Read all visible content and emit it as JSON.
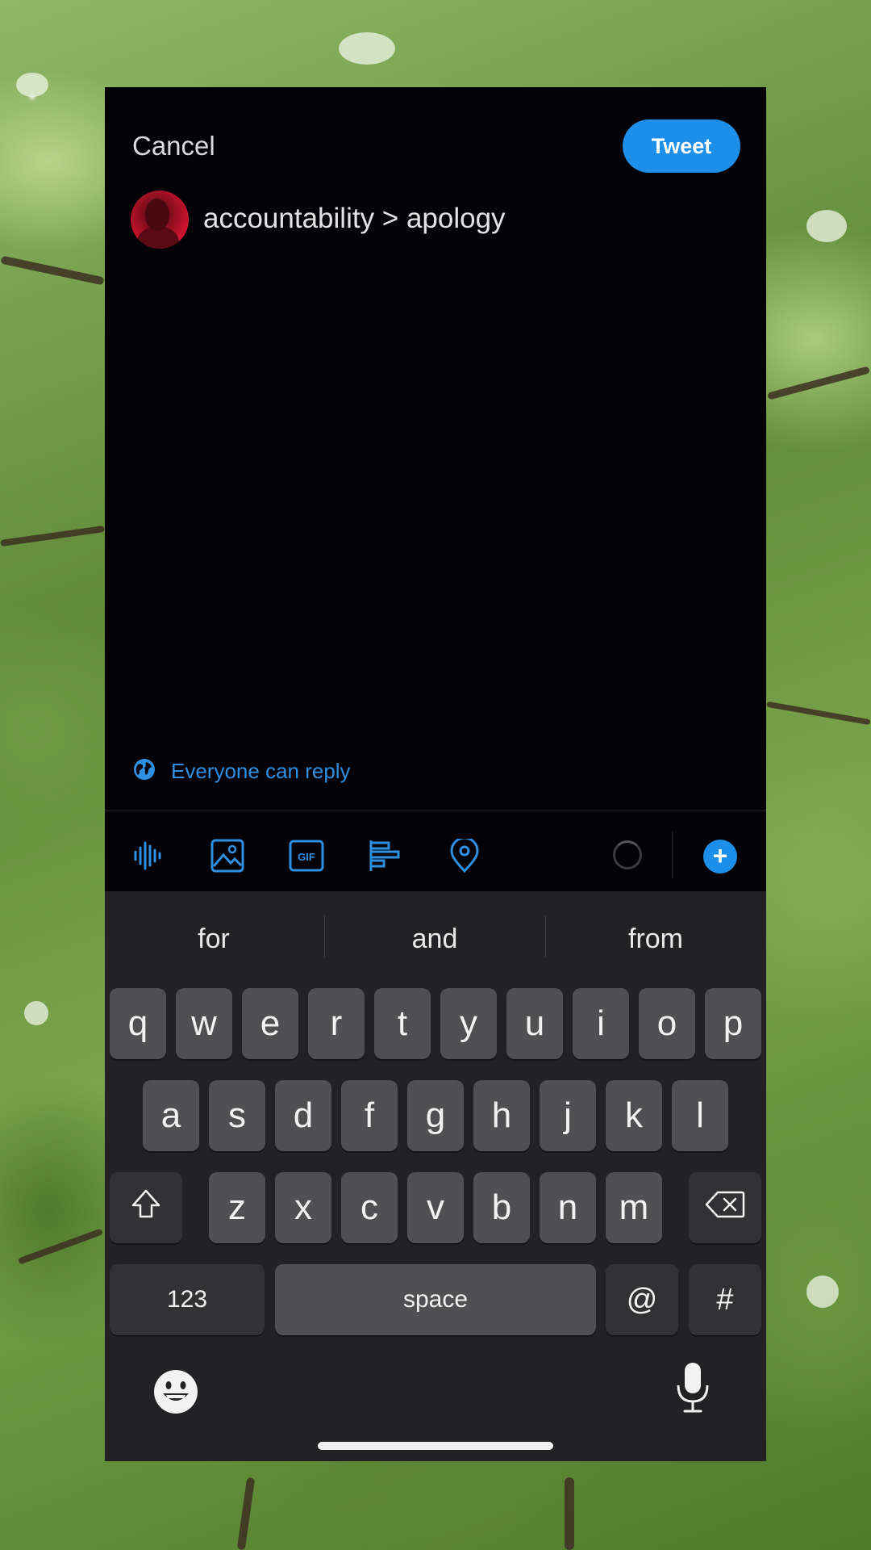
{
  "header": {
    "cancel_label": "Cancel",
    "tweet_label": "Tweet"
  },
  "compose": {
    "text": "accountability > apology"
  },
  "reply": {
    "label": "Everyone can reply"
  },
  "toolbar": {
    "icons": [
      "voice-icon",
      "image-icon",
      "gif-icon",
      "poll-icon",
      "location-icon"
    ],
    "gif_label": "GIF"
  },
  "keyboard": {
    "suggestions": [
      "for",
      "and",
      "from"
    ],
    "row1": [
      "q",
      "w",
      "e",
      "r",
      "t",
      "y",
      "u",
      "i",
      "o",
      "p"
    ],
    "row2": [
      "a",
      "s",
      "d",
      "f",
      "g",
      "h",
      "j",
      "k",
      "l"
    ],
    "row3": [
      "z",
      "x",
      "c",
      "v",
      "b",
      "n",
      "m"
    ],
    "numbers_label": "123",
    "space_label": "space",
    "at_label": "@",
    "hash_label": "#"
  },
  "colors": {
    "accent": "#1d8fe8",
    "compose_bg": "#030207",
    "keyboard_bg": "#222224"
  }
}
